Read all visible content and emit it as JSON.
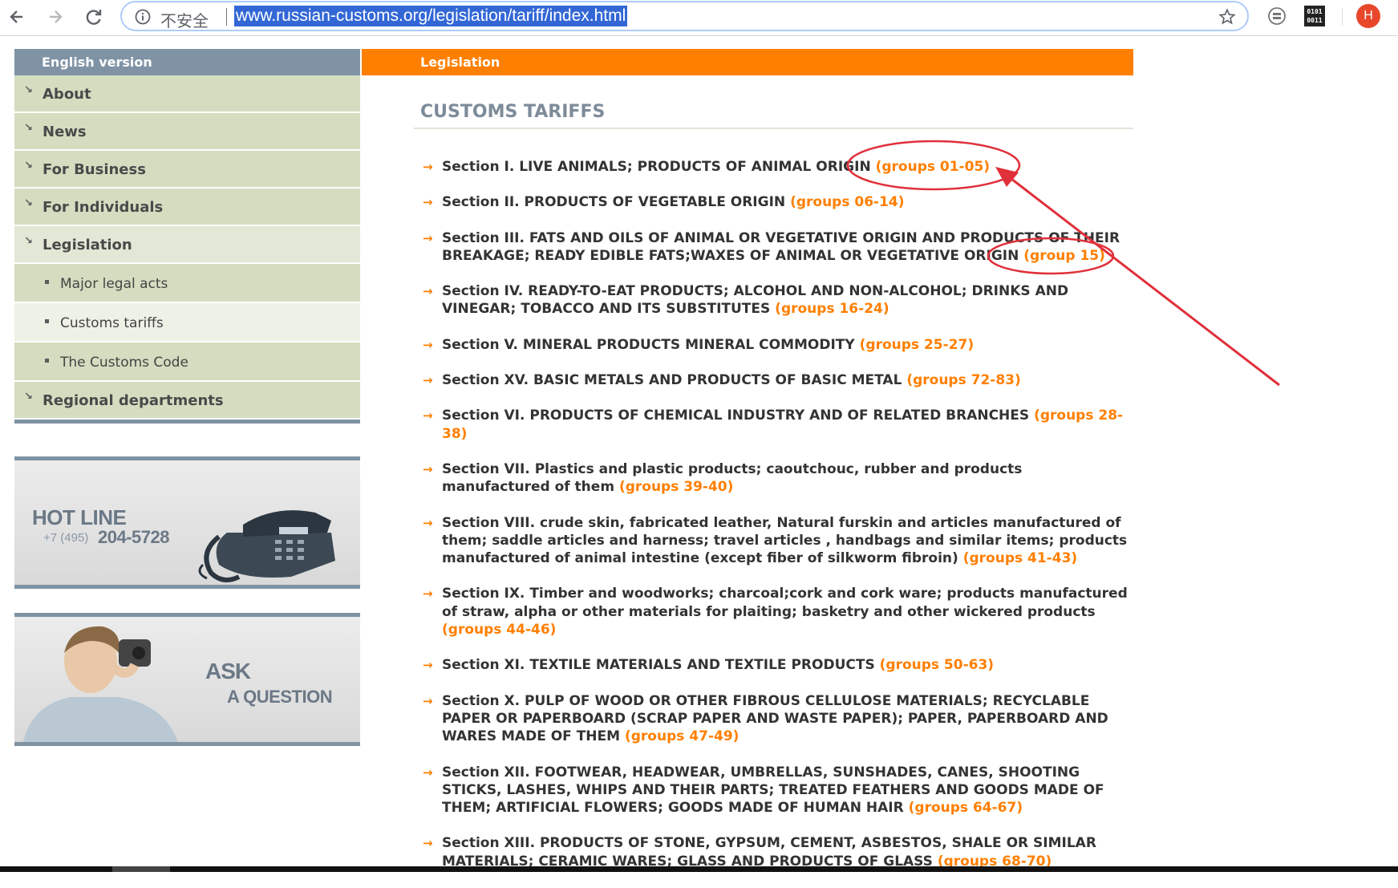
{
  "browser": {
    "security_label": "不安全",
    "url": "www.russian-customs.org/legislation/tariff/index.html",
    "profile_initial": "H",
    "ext_binary_label_top": "0101",
    "ext_binary_label_bottom": "0011"
  },
  "sidebar": {
    "header": "English version",
    "items": [
      {
        "label": "About"
      },
      {
        "label": "News"
      },
      {
        "label": "For Business"
      },
      {
        "label": "For Individuals"
      },
      {
        "label": "Legislation"
      }
    ],
    "subitems": [
      {
        "label": "Major legal acts"
      },
      {
        "label": "Customs tariffs"
      },
      {
        "label": "The Customs Code"
      }
    ],
    "last_item": {
      "label": "Regional departments"
    }
  },
  "hotline": {
    "title": "HOT LINE",
    "prefix": "+7 (495)",
    "number": "204-5728"
  },
  "ask": {
    "line1": "ASK",
    "line2": "A QUESTION"
  },
  "main": {
    "header": "Legislation",
    "title": "CUSTOMS TARIFFS",
    "sections": [
      {
        "text": "Section I. LIVE ANIMALS; PRODUCTS OF ANIMAL ORIGIN ",
        "groups": "(groups 01-05)"
      },
      {
        "text": "Section II. PRODUCTS OF VEGETABLE ORIGIN ",
        "groups": "(groups 06-14)"
      },
      {
        "text": "Section III. FATS AND OILS OF ANIMAL OR VEGETATIVE ORIGIN AND PRODUCTS OF THEIR BREAKAGE; READY EDIBLE FATS;WAXES OF ANIMAL OR VEGETATIVE ORIGIN ",
        "groups": "(group 15)"
      },
      {
        "text": "Section IV. READY-TO-EAT PRODUCTS; ALCOHOL AND NON-ALCOHOL; DRINKS AND VINEGAR; TOBACCO AND ITS SUBSTITUTES ",
        "groups": "(groups 16-24)"
      },
      {
        "text": "Section V. MINERAL PRODUCTS MINERAL COMMODITY ",
        "groups": "(groups 25-27)"
      },
      {
        "text": "Section XV. BASIC METALS AND PRODUCTS OF BASIC METAL ",
        "groups": "(groups 72-83)"
      },
      {
        "text": "Section VI. PRODUCTS OF CHEMICAL INDUSTRY AND OF RELATED BRANCHES ",
        "groups": "(groups 28-38)"
      },
      {
        "text": "Section VII. Plastics and plastic products; caoutchouc, rubber and products manufactured of them ",
        "groups": "(groups 39-40)"
      },
      {
        "text": "Section VIII. crude skin, fabricated leather, Natural furskin and articles manufactured of them; saddle articles and harness; travel articles , handbags and similar items; products manufactured of animal intestine (except fiber of silkworm fibroin) ",
        "groups": "(groups 41-43)"
      },
      {
        "text": "Section IX. Timber and woodworks; charcoal;cork and cork ware; products manufactured of straw, alpha or other materials for plaiting; basketry and other wickered products ",
        "groups": "(groups 44-46)"
      },
      {
        "text": "Section XI. TEXTILE MATERIALS AND TEXTILE PRODUCTS ",
        "groups": "(groups 50-63)"
      },
      {
        "text": "Section X. PULP OF WOOD OR OTHER FIBROUS CELLULOSE MATERIALS; RECYCLABLE PAPER OR PAPERBOARD (SCRAP PAPER AND WASTE PAPER); PAPER, PAPERBOARD AND WARES MADE OF THEM ",
        "groups": "(groups 47-49)"
      },
      {
        "text": "Section XII. FOOTWEAR, HEADWEAR, UMBRELLAS, SUNSHADES, CANES, SHOOTING STICKS, LASHES, WHIPS AND THEIR PARTS; TREATED FEATHERS AND GOODS MADE OF THEM; ARTIFICIAL FLOWERS; GOODS MADE OF HUMAN HAIR ",
        "groups": "(groups 64-67)"
      },
      {
        "text": "Section XIII. PRODUCTS OF STONE, GYPSUM, CEMENT, ASBESTOS, SHALE OR SIMILAR MATERIALS; CERAMIC WARES; GLASS AND PRODUCTS OF GLASS ",
        "groups": "(groups 68-70)"
      }
    ]
  },
  "colors": {
    "accent": "#ff7f00",
    "sidebar_header": "#7f93a5",
    "menu_bg": "#d4ddc0",
    "annotation": "#e0303a"
  }
}
